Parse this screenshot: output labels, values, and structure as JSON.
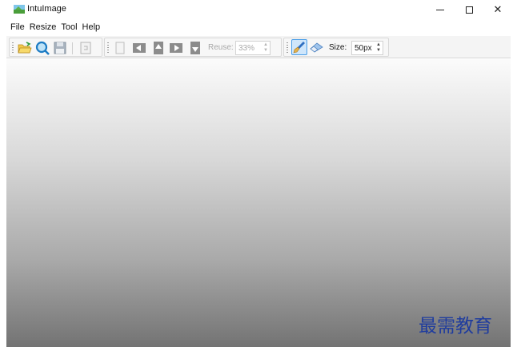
{
  "window": {
    "title": "IntuImage",
    "controls": {
      "minimize_icon": "minimize-icon",
      "maximize_icon": "maximize-icon",
      "close_glyph": "✕"
    }
  },
  "menu": {
    "items": [
      "File",
      "Resize",
      "Tool",
      "Help"
    ]
  },
  "toolbar": {
    "icons": [
      "open-folder-icon",
      "zoom-icon",
      "save-icon",
      "copy-icon",
      "page-icon",
      "arrow-left-icon",
      "arrow-up-icon",
      "arrow-right-icon",
      "arrow-down-icon",
      "brush-icon",
      "eraser-icon"
    ],
    "reuse_label": "Reuse:",
    "reuse_value": "33%",
    "size_label": "Size:",
    "size_value": "50px"
  },
  "watermark": "最需教育",
  "colors": {
    "accent": "#4b9ee8",
    "canvas_top": "#fbfbfb",
    "canvas_bottom": "#737373",
    "watermark": "#1f3c9e"
  }
}
